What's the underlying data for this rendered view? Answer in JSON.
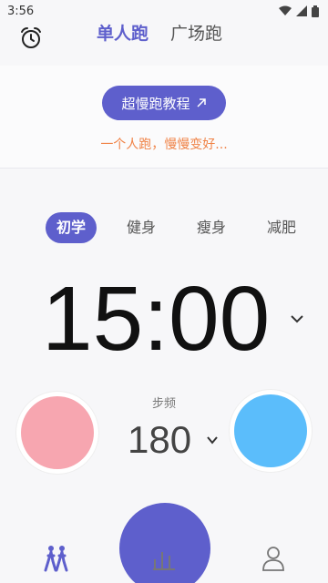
{
  "status_bar": {
    "time": "3:56"
  },
  "header": {
    "tabs": [
      {
        "label": "单人跑",
        "active": true
      },
      {
        "label": "广场跑",
        "active": false
      }
    ]
  },
  "tutorial": {
    "label": "超慢跑教程"
  },
  "slogan": "一个人跑，慢慢变好...",
  "levels": [
    {
      "label": "初学",
      "active": true
    },
    {
      "label": "健身",
      "active": false
    },
    {
      "label": "瘦身",
      "active": false
    },
    {
      "label": "减肥",
      "active": false
    }
  ],
  "timer": {
    "value": "15:00"
  },
  "cadence": {
    "label": "步频",
    "value": "180"
  },
  "colors": {
    "accent": "#5e5fcc",
    "pink": "#f7a6b0",
    "blue": "#5bbdfb",
    "slogan": "#f08347"
  },
  "icons": [
    "alarm-icon",
    "external-arrow-icon",
    "chevron-down-icon",
    "runners-icon",
    "stats-icon",
    "profile-icon"
  ]
}
